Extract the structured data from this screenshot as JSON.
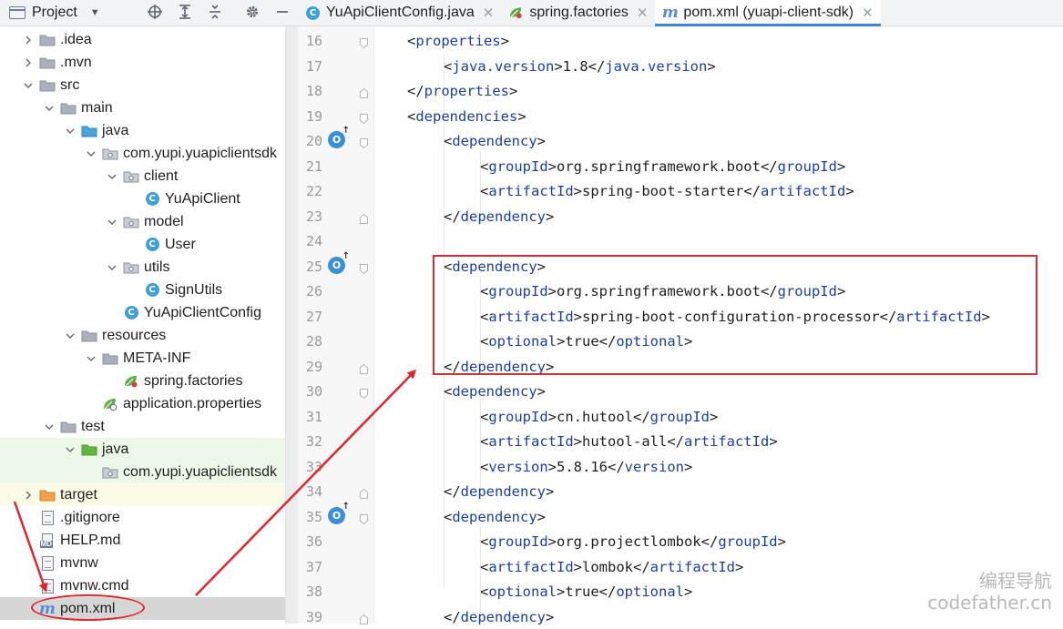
{
  "project_panel": {
    "title": "Project",
    "toolbar_icons": [
      "locate-icon",
      "expand-all-icon",
      "collapse-all-icon",
      "gear-icon",
      "hide-icon"
    ]
  },
  "tree": [
    {
      "label": ".idea",
      "icon": "folder",
      "expanded": false,
      "highlight": ""
    },
    {
      "label": ".mvn",
      "icon": "folder",
      "expanded": false,
      "highlight": ""
    },
    {
      "label": "src",
      "icon": "folder",
      "expanded": true,
      "highlight": ""
    },
    {
      "label": "main",
      "icon": "folder",
      "expanded": true,
      "highlight": ""
    },
    {
      "label": "java",
      "icon": "source-folder",
      "expanded": true,
      "highlight": ""
    },
    {
      "label": "com.yupi.yuapiclientsdk",
      "icon": "package",
      "expanded": true,
      "highlight": ""
    },
    {
      "label": "client",
      "icon": "package",
      "expanded": true,
      "highlight": ""
    },
    {
      "label": "YuApiClient",
      "icon": "class",
      "expanded": null,
      "highlight": ""
    },
    {
      "label": "model",
      "icon": "package",
      "expanded": true,
      "highlight": ""
    },
    {
      "label": "User",
      "icon": "class",
      "expanded": null,
      "highlight": ""
    },
    {
      "label": "utils",
      "icon": "package",
      "expanded": true,
      "highlight": ""
    },
    {
      "label": "SignUtils",
      "icon": "class",
      "expanded": null,
      "highlight": ""
    },
    {
      "label": "YuApiClientConfig",
      "icon": "class",
      "expanded": null,
      "highlight": ""
    },
    {
      "label": "resources",
      "icon": "resources-folder",
      "expanded": true,
      "highlight": ""
    },
    {
      "label": "META-INF",
      "icon": "folder",
      "expanded": true,
      "highlight": ""
    },
    {
      "label": "spring.factories",
      "icon": "spring-file",
      "expanded": null,
      "highlight": ""
    },
    {
      "label": "application.properties",
      "icon": "spring-properties",
      "expanded": null,
      "highlight": ""
    },
    {
      "label": "test",
      "icon": "folder",
      "expanded": true,
      "highlight": ""
    },
    {
      "label": "java",
      "icon": "test-folder",
      "expanded": true,
      "highlight": "green"
    },
    {
      "label": "com.yupi.yuapiclientsdk",
      "icon": "package",
      "expanded": null,
      "highlight": "green"
    },
    {
      "label": "target",
      "icon": "excluded-folder",
      "expanded": false,
      "highlight": "yellow"
    },
    {
      "label": ".gitignore",
      "icon": "gitignore-file",
      "expanded": null,
      "highlight": ""
    },
    {
      "label": "HELP.md",
      "icon": "md-file",
      "expanded": null,
      "highlight": ""
    },
    {
      "label": "mvnw",
      "icon": "text-file",
      "expanded": null,
      "highlight": ""
    },
    {
      "label": "mvnw.cmd",
      "icon": "text-file",
      "expanded": null,
      "highlight": ""
    },
    {
      "label": "pom.xml",
      "icon": "maven-file",
      "expanded": null,
      "highlight": "selected"
    }
  ],
  "tabs": [
    {
      "label": "YuApiClientConfig.java",
      "icon": "class-icon",
      "active": false
    },
    {
      "label": "spring.factories",
      "icon": "spring-file-icon",
      "active": false
    },
    {
      "label": "pom.xml (yuapi-client-sdk)",
      "icon": "maven-icon",
      "active": true
    }
  ],
  "editor": {
    "lines": [
      {
        "n": "16",
        "indent": 1,
        "parts": [
          [
            "t",
            "<"
          ],
          [
            "g",
            "properties"
          ],
          [
            "t",
            ">"
          ]
        ],
        "mark": false
      },
      {
        "n": "17",
        "indent": 2,
        "parts": [
          [
            "t",
            "<"
          ],
          [
            "g",
            "java.version"
          ],
          [
            "t",
            ">1.8</"
          ],
          [
            "g",
            "java.version"
          ],
          [
            "t",
            ">"
          ]
        ],
        "mark": false
      },
      {
        "n": "18",
        "indent": 1,
        "parts": [
          [
            "t",
            "</"
          ],
          [
            "g",
            "properties"
          ],
          [
            "t",
            ">"
          ]
        ],
        "mark": false
      },
      {
        "n": "19",
        "indent": 1,
        "parts": [
          [
            "t",
            "<"
          ],
          [
            "g",
            "dependencies"
          ],
          [
            "t",
            ">"
          ]
        ],
        "mark": false
      },
      {
        "n": "20",
        "indent": 2,
        "parts": [
          [
            "t",
            "<"
          ],
          [
            "g",
            "dependency"
          ],
          [
            "t",
            ">"
          ]
        ],
        "mark": true
      },
      {
        "n": "21",
        "indent": 3,
        "parts": [
          [
            "t",
            "<"
          ],
          [
            "g",
            "groupId"
          ],
          [
            "t",
            ">org.springframework.boot</"
          ],
          [
            "g",
            "groupId"
          ],
          [
            "t",
            ">"
          ]
        ],
        "mark": false
      },
      {
        "n": "22",
        "indent": 3,
        "parts": [
          [
            "t",
            "<"
          ],
          [
            "g",
            "artifactId"
          ],
          [
            "t",
            ">spring-boot-starter</"
          ],
          [
            "g",
            "artifactId"
          ],
          [
            "t",
            ">"
          ]
        ],
        "mark": false
      },
      {
        "n": "23",
        "indent": 2,
        "parts": [
          [
            "t",
            "</"
          ],
          [
            "g",
            "dependency"
          ],
          [
            "t",
            ">"
          ]
        ],
        "mark": false
      },
      {
        "n": "24",
        "indent": 0,
        "parts": [],
        "mark": false
      },
      {
        "n": "25",
        "indent": 2,
        "parts": [
          [
            "t",
            "<"
          ],
          [
            "g",
            "dependency"
          ],
          [
            "t",
            ">"
          ]
        ],
        "mark": true
      },
      {
        "n": "26",
        "indent": 3,
        "parts": [
          [
            "t",
            "<"
          ],
          [
            "g",
            "groupId"
          ],
          [
            "t",
            ">org.springframework.boot</"
          ],
          [
            "g",
            "groupId"
          ],
          [
            "t",
            ">"
          ]
        ],
        "mark": false
      },
      {
        "n": "27",
        "indent": 3,
        "parts": [
          [
            "t",
            "<"
          ],
          [
            "g",
            "artifactId"
          ],
          [
            "t",
            ">spring-boot-configuration-processor</"
          ],
          [
            "g",
            "artifactId"
          ],
          [
            "t",
            ">"
          ]
        ],
        "mark": false
      },
      {
        "n": "28",
        "indent": 3,
        "parts": [
          [
            "t",
            "<"
          ],
          [
            "g",
            "optional"
          ],
          [
            "t",
            ">true</"
          ],
          [
            "g",
            "optional"
          ],
          [
            "t",
            ">"
          ]
        ],
        "mark": false
      },
      {
        "n": "29",
        "indent": 2,
        "parts": [
          [
            "t",
            "</"
          ],
          [
            "g",
            "dependency"
          ],
          [
            "t",
            ">"
          ]
        ],
        "mark": false
      },
      {
        "n": "30",
        "indent": 2,
        "parts": [
          [
            "t",
            "<"
          ],
          [
            "g",
            "dependency"
          ],
          [
            "t",
            ">"
          ]
        ],
        "mark": false
      },
      {
        "n": "31",
        "indent": 3,
        "parts": [
          [
            "t",
            "<"
          ],
          [
            "g",
            "groupId"
          ],
          [
            "t",
            ">cn.hutool</"
          ],
          [
            "g",
            "groupId"
          ],
          [
            "t",
            ">"
          ]
        ],
        "mark": false
      },
      {
        "n": "32",
        "indent": 3,
        "parts": [
          [
            "t",
            "<"
          ],
          [
            "g",
            "artifactId"
          ],
          [
            "t",
            ">hutool-all</"
          ],
          [
            "g",
            "artifactId"
          ],
          [
            "t",
            ">"
          ]
        ],
        "mark": false
      },
      {
        "n": "33",
        "indent": 3,
        "parts": [
          [
            "t",
            "<"
          ],
          [
            "g",
            "version"
          ],
          [
            "t",
            ">5.8.16</"
          ],
          [
            "g",
            "version"
          ],
          [
            "t",
            ">"
          ]
        ],
        "mark": false
      },
      {
        "n": "34",
        "indent": 2,
        "parts": [
          [
            "t",
            "</"
          ],
          [
            "g",
            "dependency"
          ],
          [
            "t",
            ">"
          ]
        ],
        "mark": false
      },
      {
        "n": "35",
        "indent": 2,
        "parts": [
          [
            "t",
            "<"
          ],
          [
            "g",
            "dependency"
          ],
          [
            "t",
            ">"
          ]
        ],
        "mark": true
      },
      {
        "n": "36",
        "indent": 3,
        "parts": [
          [
            "t",
            "<"
          ],
          [
            "g",
            "groupId"
          ],
          [
            "t",
            ">org.projectlombok</"
          ],
          [
            "g",
            "groupId"
          ],
          [
            "t",
            ">"
          ]
        ],
        "mark": false
      },
      {
        "n": "37",
        "indent": 3,
        "parts": [
          [
            "t",
            "<"
          ],
          [
            "g",
            "artifactId"
          ],
          [
            "t",
            ">lombok</"
          ],
          [
            "g",
            "artifactId"
          ],
          [
            "t",
            ">"
          ]
        ],
        "mark": false
      },
      {
        "n": "38",
        "indent": 3,
        "parts": [
          [
            "t",
            "<"
          ],
          [
            "g",
            "optional"
          ],
          [
            "t",
            ">true</"
          ],
          [
            "g",
            "optional"
          ],
          [
            "t",
            ">"
          ]
        ],
        "mark": false
      },
      {
        "n": "39",
        "indent": 2,
        "parts": [
          [
            "t",
            "</"
          ],
          [
            "g",
            "dependency"
          ],
          [
            "t",
            ">"
          ]
        ],
        "mark": false
      }
    ]
  },
  "watermark": {
    "line1": "编程导航",
    "line2": "codefather.cn"
  },
  "colors": {
    "tag": "#1b3fa3",
    "accent": "#3d83e0",
    "annotation": "#e0262c"
  }
}
